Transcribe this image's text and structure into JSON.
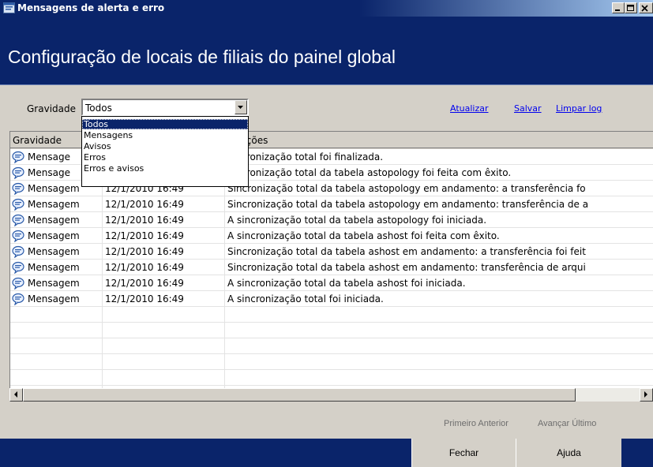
{
  "window": {
    "title": "Mensagens de alerta e erro",
    "header_title": "Configuração de locais de filiais do painel global"
  },
  "filter": {
    "label": "Gravidade",
    "selected": "Todos",
    "options": [
      "Todos",
      "Mensagens",
      "Avisos",
      "Erros",
      "Erros e avisos"
    ]
  },
  "links": {
    "refresh": "Atualizar",
    "save": "Salvar",
    "clear_log": "Limpar log"
  },
  "table": {
    "columns": [
      "Gravidade",
      "",
      "rmações"
    ],
    "rows": [
      [
        "Mensage",
        "",
        "sincronização total foi finalizada."
      ],
      [
        "Mensage",
        "",
        "sincronização total da tabela astopology foi feita com êxito."
      ],
      [
        "Mensagem",
        "12/1/2010 16:49",
        "Sincronização total da tabela astopology em andamento: a transferência fo"
      ],
      [
        "Mensagem",
        "12/1/2010 16:49",
        "Sincronização total da tabela astopology em andamento: transferência de a"
      ],
      [
        "Mensagem",
        "12/1/2010 16:49",
        "A sincronização total da tabela astopology foi iniciada."
      ],
      [
        "Mensagem",
        "12/1/2010 16:49",
        "A sincronização total da tabela ashost foi feita com êxito."
      ],
      [
        "Mensagem",
        "12/1/2010 16:49",
        "Sincronização total da tabela ashost em andamento: a transferência foi feit"
      ],
      [
        "Mensagem",
        "12/1/2010 16:49",
        "Sincronização total da tabela ashost em andamento: transferência de arqui"
      ],
      [
        "Mensagem",
        "12/1/2010 16:49",
        "A sincronização total da tabela ashost foi iniciada."
      ],
      [
        "Mensagem",
        "12/1/2010 16:49",
        "A sincronização total foi iniciada."
      ]
    ]
  },
  "pager": {
    "first_prev": "Primeiro Anterior",
    "next_last": "Avançar Último"
  },
  "footer": {
    "close": "Fechar",
    "help": "Ajuda"
  },
  "icons": {
    "row_icon": "message-bubble-icon",
    "app_icon": "app-window-icon"
  },
  "colors": {
    "header_bg": "#0a246a",
    "link": "#0000ee",
    "selection": "#0a246a"
  }
}
